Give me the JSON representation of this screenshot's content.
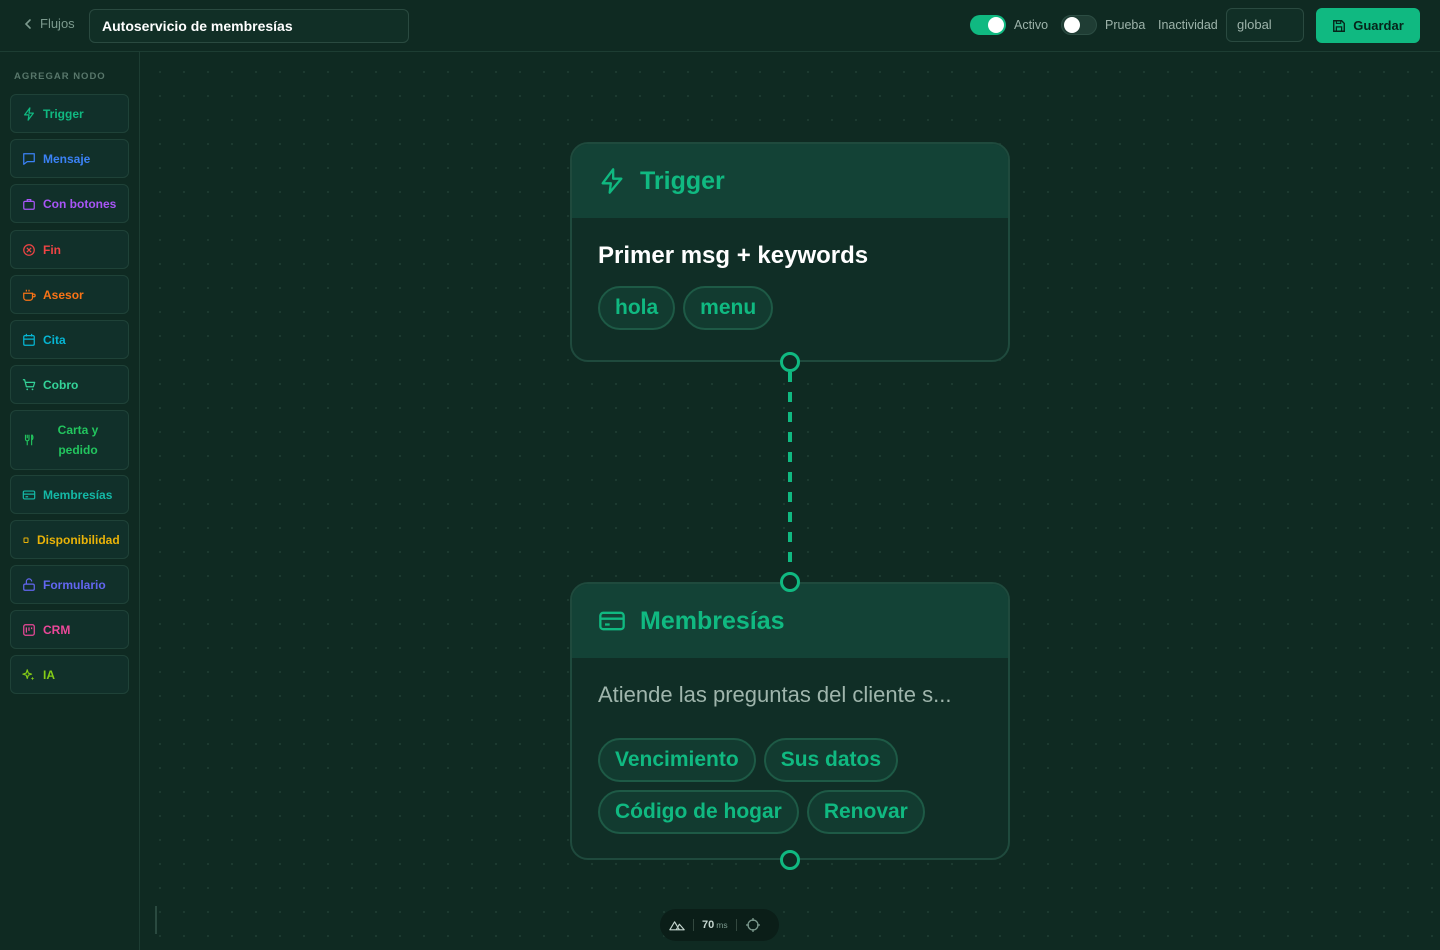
{
  "header": {
    "back_label": "Flujos",
    "flow_title": "Autoservicio de membresías",
    "toggles": [
      {
        "label": "Activo",
        "on": true
      },
      {
        "label": "Prueba",
        "on": false
      }
    ],
    "inactivity_label": "Inactividad",
    "inactivity_value": "global",
    "save_label": "Guardar"
  },
  "sidebar": {
    "title": "AGREGAR NODO",
    "items": [
      {
        "label": "Trigger",
        "icon": "bolt-icon",
        "color": "#10b981"
      },
      {
        "label": "Mensaje",
        "icon": "message-icon",
        "color": "#3b82f6"
      },
      {
        "label": "Con botones",
        "icon": "buttons-icon",
        "color": "#a855f7"
      },
      {
        "label": "Fin",
        "icon": "x-circle-icon",
        "color": "#ef4444"
      },
      {
        "label": "Asesor",
        "icon": "coffee-icon",
        "color": "#f97316"
      },
      {
        "label": "Cita",
        "icon": "calendar-icon",
        "color": "#06b6d4"
      },
      {
        "label": "Cobro",
        "icon": "cart-icon",
        "color": "#34d399"
      },
      {
        "label": "Carta y pedido",
        "icon": "utensils-icon",
        "color": "#22c55e"
      },
      {
        "label": "Membresías",
        "icon": "card-icon",
        "color": "#14b8a6"
      },
      {
        "label": "Disponibilidad",
        "icon": "box-icon",
        "color": "#eab308"
      },
      {
        "label": "Formulario",
        "icon": "form-icon",
        "color": "#6366f1"
      },
      {
        "label": "CRM",
        "icon": "crm-icon",
        "color": "#ec4899"
      },
      {
        "label": "IA",
        "icon": "sparkles-icon",
        "color": "#84cc16"
      }
    ]
  },
  "canvas": {
    "trigger_node": {
      "title": "Trigger",
      "description": "Primer msg + keywords",
      "keywords": [
        "hola",
        "menu"
      ]
    },
    "membership_node": {
      "title": "Membresías",
      "description": "Atiende las preguntas del cliente s...",
      "options": [
        "Vencimiento",
        "Sus datos",
        "Código de hogar",
        "Renovar"
      ]
    }
  },
  "bottom_bar": {
    "latency_value": "70",
    "latency_unit": "ms"
  },
  "colors": {
    "accent": "#10b981",
    "background": "#0f2a22"
  }
}
